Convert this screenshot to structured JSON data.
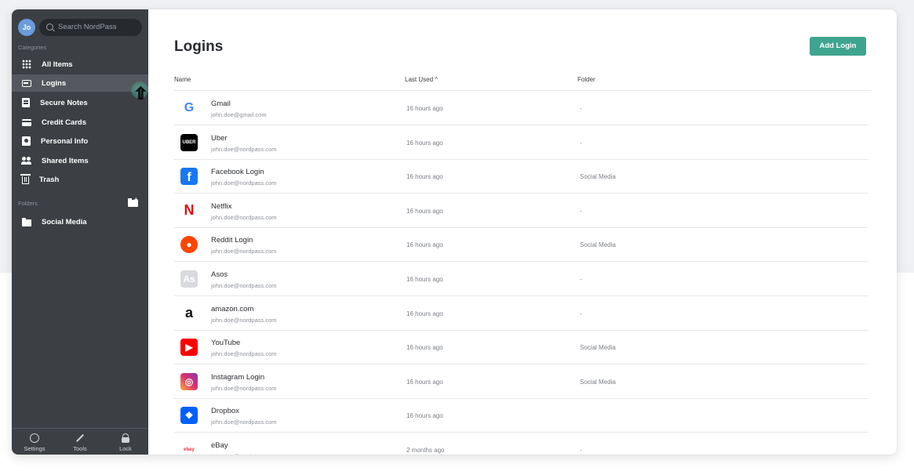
{
  "app": {
    "user_initials": "Jo",
    "search_placeholder": "Search NordPass"
  },
  "sidebar": {
    "categories_label": "Categories",
    "folders_label": "Folders",
    "items": [
      {
        "label": "All Items",
        "icon": "grid-icon"
      },
      {
        "label": "Logins",
        "icon": "login-card-icon",
        "active": true
      },
      {
        "label": "Secure Notes",
        "icon": "note-icon"
      },
      {
        "label": "Credit Cards",
        "icon": "credit-card-icon"
      },
      {
        "label": "Personal Info",
        "icon": "person-icon"
      },
      {
        "label": "Shared Items",
        "icon": "shared-users-icon"
      },
      {
        "label": "Trash",
        "icon": "trash-icon"
      }
    ],
    "folders": [
      {
        "label": "Social Media",
        "icon": "folder-icon"
      }
    ],
    "bottom": [
      {
        "label": "Settings",
        "icon": "settings-icon"
      },
      {
        "label": "Tools",
        "icon": "wrench-icon"
      },
      {
        "label": "Lock",
        "icon": "lock-icon"
      }
    ]
  },
  "main": {
    "title": "Logins",
    "add_button": "Add Login",
    "columns": {
      "name": "Name",
      "last_used": "Last Used ^",
      "folder": "Folder"
    },
    "rows": [
      {
        "title": "Gmail",
        "email": "john.doe@gmail.com",
        "used": "16 hours ago",
        "folder": "-",
        "logo": "G",
        "logo_bg": "#ffffff",
        "logo_color": "#4285f4"
      },
      {
        "title": "Uber",
        "email": "john.doe@nordpass.com",
        "used": "16 hours ago",
        "folder": "-",
        "logo": "UBER",
        "logo_bg": "#000000",
        "logo_color": "#ffffff"
      },
      {
        "title": "Facebook Login",
        "email": "john.doe@nordpass.com",
        "used": "16 hours ago",
        "folder": "Social Media",
        "logo": "f",
        "logo_bg": "#1877f2",
        "logo_color": "#ffffff"
      },
      {
        "title": "Netflix",
        "email": "john.doe@nordpass.com",
        "used": "16 hours ago",
        "folder": "-",
        "logo": "N",
        "logo_bg": "#ffffff",
        "logo_color": "#e50914"
      },
      {
        "title": "Reddit Login",
        "email": "john.doe@nordpass.com",
        "used": "16 hours ago",
        "folder": "Social Media",
        "logo": "●",
        "logo_bg": "#ff4500",
        "logo_color": "#ffffff"
      },
      {
        "title": "Asos",
        "email": "john.doe@nordpass.com",
        "used": "16 hours ago",
        "folder": "-",
        "logo": "As",
        "logo_bg": "#d9dadd",
        "logo_color": "#ffffff"
      },
      {
        "title": "amazon.com",
        "email": "john.doe@nordpass.com",
        "used": "16 hours ago",
        "folder": "-",
        "logo": "a",
        "logo_bg": "#ffffff",
        "logo_color": "#111111"
      },
      {
        "title": "YouTube",
        "email": "john.doe@nordpass.com",
        "used": "16 hours ago",
        "folder": "Social Media",
        "logo": "▶",
        "logo_bg": "#ff0000",
        "logo_color": "#ffffff"
      },
      {
        "title": "Instagram Login",
        "email": "john.doe@nordpass.com",
        "used": "16 hours ago",
        "folder": "Social Media",
        "logo": "◎",
        "logo_bg": "#c1358f",
        "logo_color": "#ffffff"
      },
      {
        "title": "Dropbox",
        "email": "john.doe@nordpass.com",
        "used": "16 hours ago",
        "folder": "",
        "logo": "❖",
        "logo_bg": "#0061fe",
        "logo_color": "#ffffff"
      },
      {
        "title": "eBay",
        "email": "john.doe@nordpass.com",
        "used": "2 months ago",
        "folder": "-",
        "logo": "ebay",
        "logo_bg": "#ffffff",
        "logo_color": "#e53238"
      }
    ]
  },
  "colors": {
    "sidebar_bg": "#3c3f44",
    "accent": "#3fa48f"
  }
}
